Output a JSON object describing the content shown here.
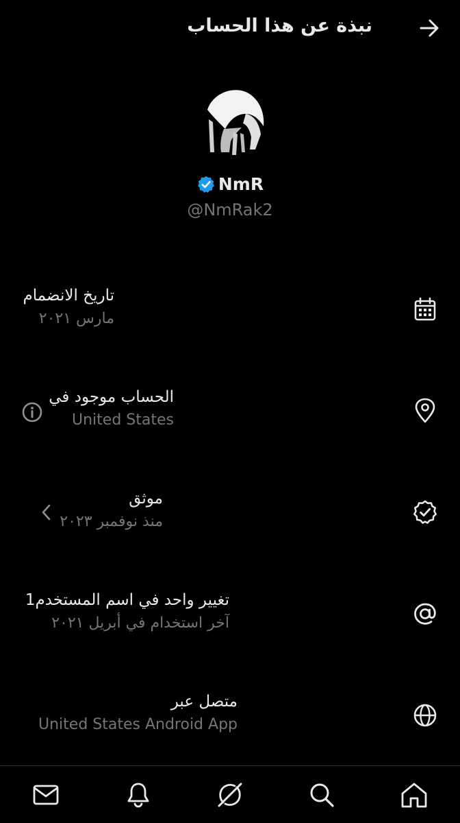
{
  "header": {
    "title": "نبذة عن هذا الحساب"
  },
  "profile": {
    "display_name": "NmR",
    "handle": "@NmRak2",
    "verified": true,
    "badge_color": "#1d9bf0"
  },
  "rows": [
    {
      "icon": "calendar-icon",
      "label": "تاريخ الانضمام",
      "sub": "مارس ٢٠٢١"
    },
    {
      "icon": "location-pin-icon",
      "label": "الحساب موجود في",
      "sub": "United States",
      "side_icon": "info-icon"
    },
    {
      "icon": "verified-badge-icon",
      "label": "موثق",
      "sub": "منذ نوفمبر ٢٠٢٣",
      "side_icon": "chevron-left-icon"
    },
    {
      "icon": "at-sign-icon",
      "label": "تغيير واحد في اسم المستخدم1",
      "sub": "آخر استخدام في أبريل ٢٠٢١"
    },
    {
      "icon": "globe-icon",
      "label": "متصل عبر",
      "sub": "United States Android App"
    }
  ],
  "tabbar": [
    {
      "icon": "mail-icon"
    },
    {
      "icon": "bell-icon"
    },
    {
      "icon": "grok-icon"
    },
    {
      "icon": "search-icon"
    },
    {
      "icon": "home-icon"
    }
  ],
  "colors": {
    "background": "#000000",
    "text_primary": "#e7e9ea",
    "text_secondary": "#71767b",
    "divider": "#2f3336"
  }
}
